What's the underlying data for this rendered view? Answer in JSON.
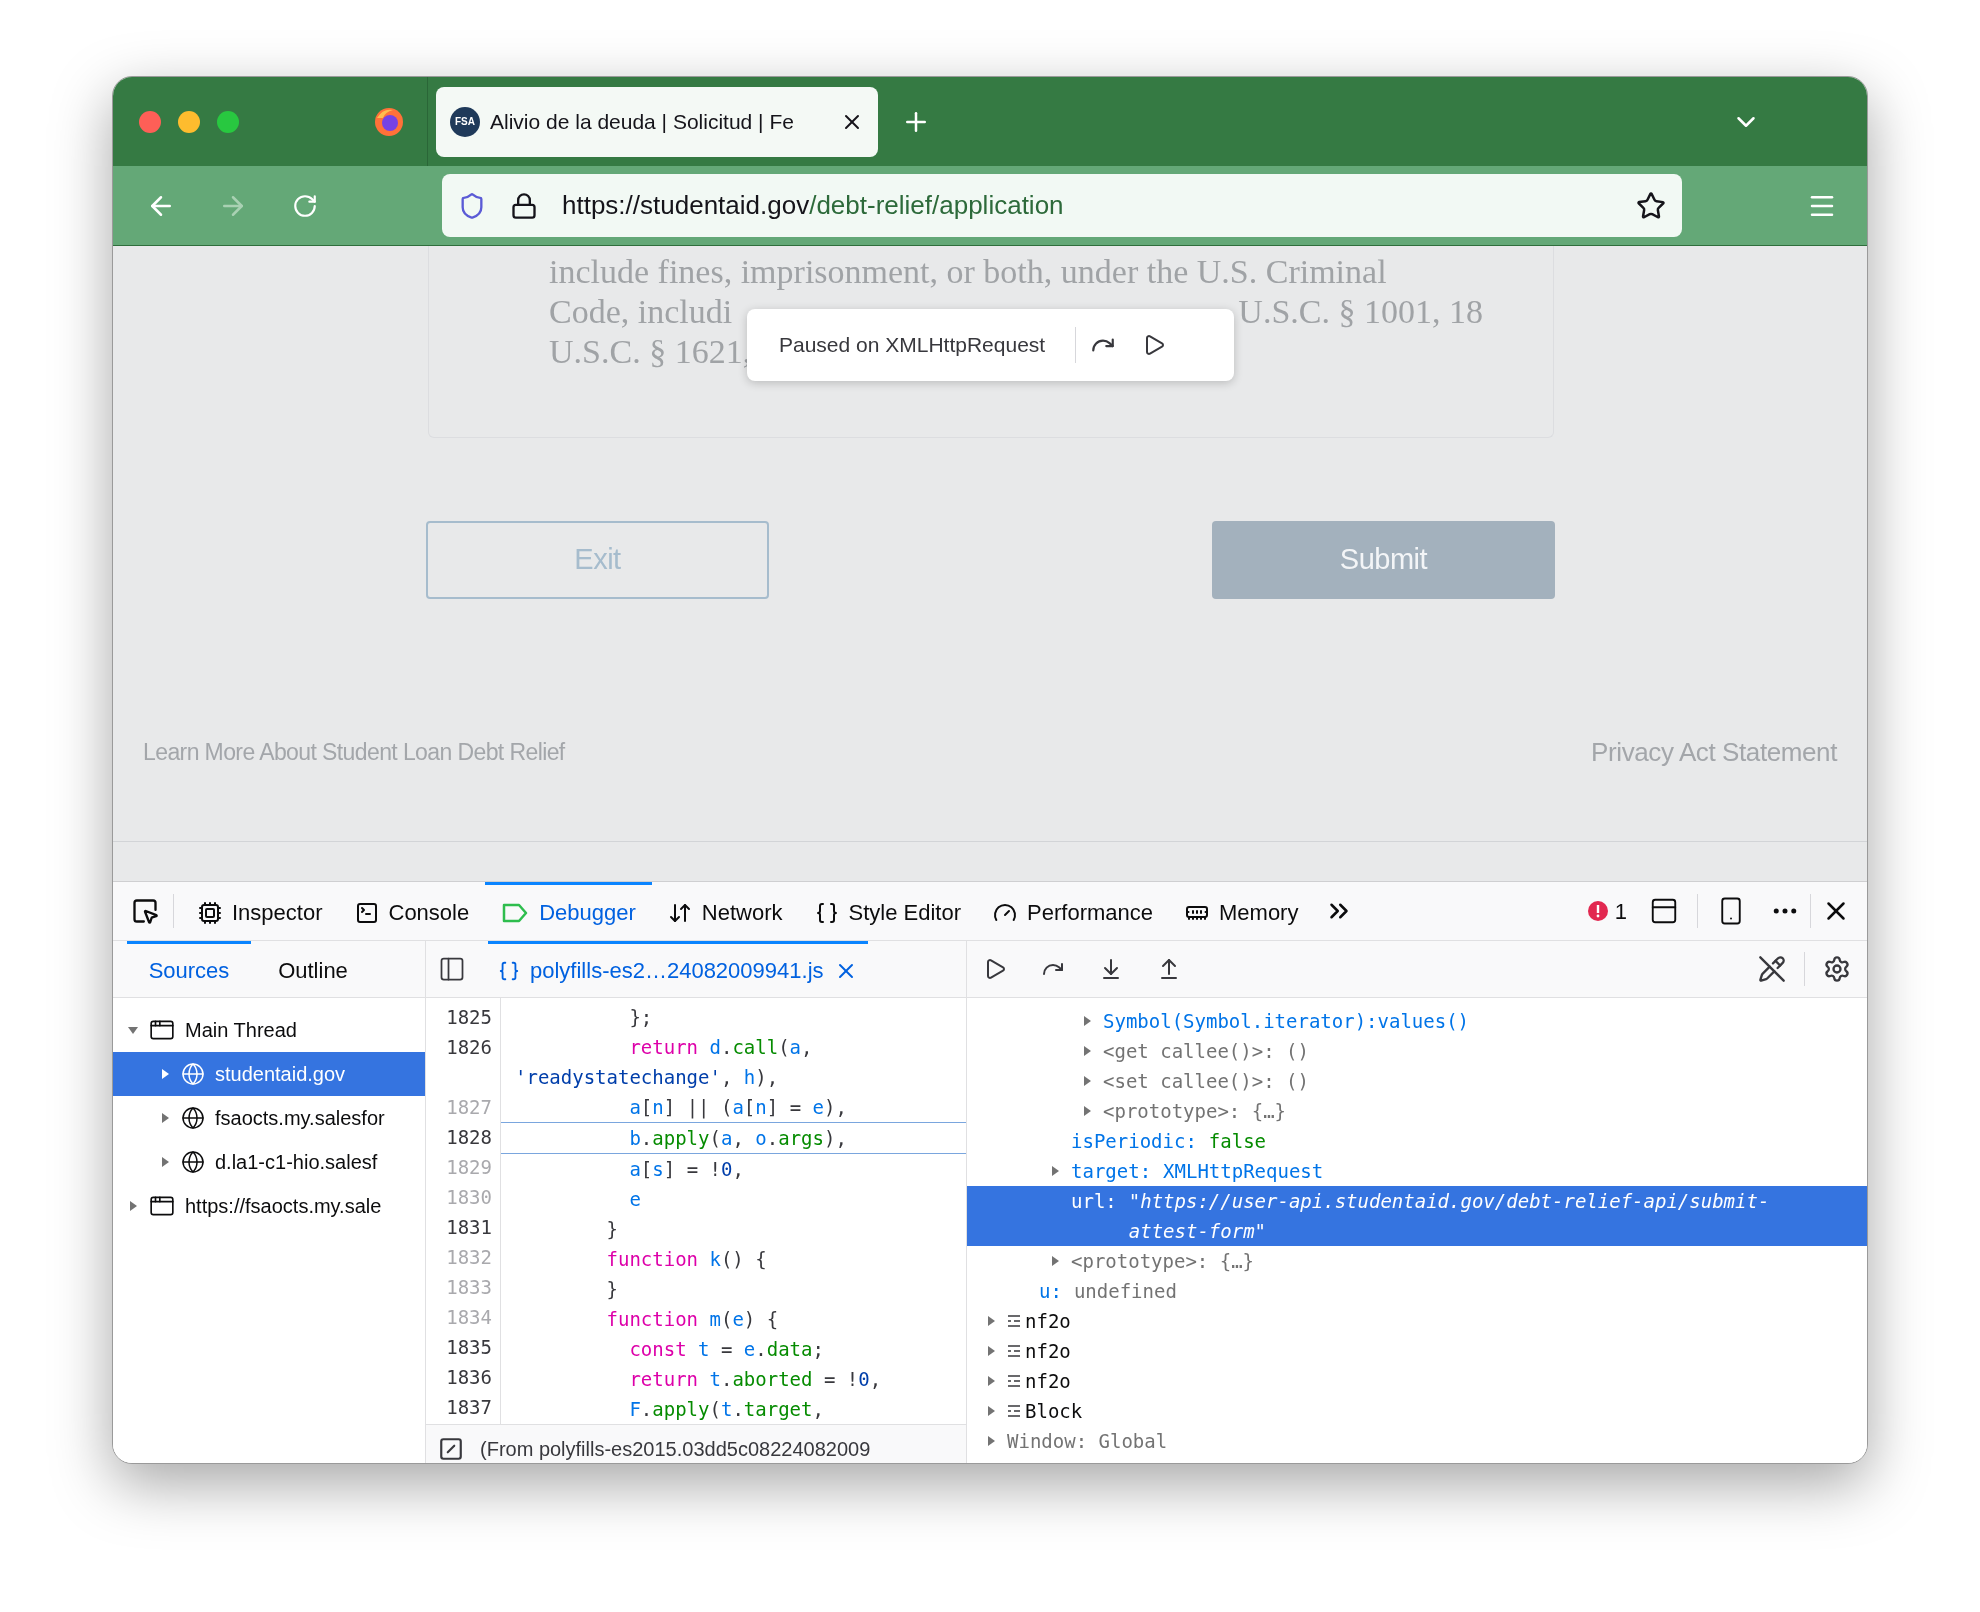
{
  "browser": {
    "tab": {
      "favicon_text": "FSA",
      "title": "Alivio de la deuda | Solicitud | Fe",
      "selected": true
    },
    "nav_buttons": [
      {
        "kind": "back",
        "disabled": false
      },
      {
        "kind": "forward",
        "disabled": true
      },
      {
        "kind": "reload",
        "disabled": false
      }
    ],
    "url": {
      "host": "https://studentaid.gov",
      "path": "/debt-relief/application"
    }
  },
  "page": {
    "legal_text": [
      {
        "parts": [
          "include fines, imprisonment, or both, under the U.S. Criminal"
        ]
      },
      {
        "parts": [
          "Code, includi",
          "U.S.C. § 1001, 18"
        ]
      },
      {
        "parts": [
          "U.S.C. § 1621,"
        ]
      }
    ],
    "paused_popup": {
      "label": "Paused on XMLHttpRequest"
    },
    "buttons": [
      {
        "label": "Exit",
        "kind": "outline"
      },
      {
        "label": "Submit",
        "kind": "filled"
      }
    ],
    "footer_links": [
      "Learn More About Student Loan Debt Relief",
      "Privacy Act Statement"
    ]
  },
  "devtools": {
    "tools": [
      {
        "label": "Inspector",
        "kind": "inspector",
        "selected": false
      },
      {
        "label": "Console",
        "kind": "console",
        "selected": false
      },
      {
        "label": "Debugger",
        "kind": "debugger",
        "selected": true
      },
      {
        "label": "Network",
        "kind": "network",
        "selected": false
      },
      {
        "label": "Style Editor",
        "kind": "style",
        "selected": false
      },
      {
        "label": "Performance",
        "kind": "performance",
        "selected": false
      },
      {
        "label": "Memory",
        "kind": "memory",
        "selected": false
      }
    ],
    "error_count": "1",
    "sidebar_tabs": [
      {
        "label": "Sources",
        "selected": true
      },
      {
        "label": "Outline",
        "selected": false
      }
    ],
    "source_tree": [
      {
        "label": "Main Thread",
        "kind": "thread",
        "expanded": true,
        "selected": false,
        "children": [
          {
            "label": "studentaid.gov",
            "kind": "domain",
            "expanded": false,
            "selected": true
          },
          {
            "label": "fsaocts.my.salesfor",
            "kind": "domain",
            "expanded": false,
            "selected": false
          },
          {
            "label": "d.la1-c1-hio.salesf",
            "kind": "domain",
            "expanded": false,
            "selected": false
          }
        ]
      },
      {
        "label": "https://fsaocts.my.sale",
        "kind": "thread",
        "expanded": false,
        "selected": false
      }
    ],
    "file_tab": {
      "label": "polyfills-es2…24082009941.js",
      "selected": true
    },
    "code_lines": [
      {
        "number": "1825",
        "breakable": true,
        "paused": false,
        "tokens": [
          {
            "kind": "punct",
            "text": "          };"
          }
        ]
      },
      {
        "number": "1826",
        "breakable": true,
        "paused": false,
        "tokens": [
          {
            "kind": "kw",
            "text": "          return"
          },
          {
            "kind": "id",
            "text": " d"
          },
          {
            "kind": "punct",
            "text": "."
          },
          {
            "kind": "prop",
            "text": "call"
          },
          {
            "kind": "punct",
            "text": "("
          },
          {
            "kind": "id",
            "text": "a"
          },
          {
            "kind": "punct",
            "text": ","
          },
          {
            "kind": "nl"
          },
          {
            "kind": "str",
            "text": "'readystatechange'"
          },
          {
            "kind": "punct",
            "text": ", "
          },
          {
            "kind": "id",
            "text": "h"
          },
          {
            "kind": "punct",
            "text": "),"
          }
        ]
      },
      {
        "number": "1827",
        "breakable": false,
        "paused": false,
        "tokens": [
          {
            "kind": "id",
            "text": "          a"
          },
          {
            "kind": "punct",
            "text": "["
          },
          {
            "kind": "id",
            "text": "n"
          },
          {
            "kind": "punct",
            "text": "] || ("
          },
          {
            "kind": "id",
            "text": "a"
          },
          {
            "kind": "punct",
            "text": "["
          },
          {
            "kind": "id",
            "text": "n"
          },
          {
            "kind": "punct",
            "text": "] = "
          },
          {
            "kind": "id",
            "text": "e"
          },
          {
            "kind": "punct",
            "text": "),"
          }
        ]
      },
      {
        "number": "1828",
        "breakable": true,
        "paused": true,
        "tokens": [
          {
            "kind": "id",
            "text": "          b"
          },
          {
            "kind": "punct",
            "text": "."
          },
          {
            "kind": "prop",
            "text": "apply"
          },
          {
            "kind": "punct",
            "text": "("
          },
          {
            "kind": "id",
            "text": "a"
          },
          {
            "kind": "punct",
            "text": ", "
          },
          {
            "kind": "id",
            "text": "o"
          },
          {
            "kind": "punct",
            "text": "."
          },
          {
            "kind": "prop",
            "text": "args"
          },
          {
            "kind": "punct",
            "text": "),"
          }
        ]
      },
      {
        "number": "1829",
        "breakable": false,
        "paused": false,
        "tokens": [
          {
            "kind": "id",
            "text": "          a"
          },
          {
            "kind": "punct",
            "text": "["
          },
          {
            "kind": "id",
            "text": "s"
          },
          {
            "kind": "punct",
            "text": "] = !"
          },
          {
            "kind": "num",
            "text": "0"
          },
          {
            "kind": "punct",
            "text": ","
          }
        ]
      },
      {
        "number": "1830",
        "breakable": false,
        "paused": false,
        "tokens": [
          {
            "kind": "id",
            "text": "          e"
          }
        ]
      },
      {
        "number": "1831",
        "breakable": true,
        "paused": false,
        "tokens": [
          {
            "kind": "punct",
            "text": "        }"
          }
        ]
      },
      {
        "number": "1832",
        "breakable": false,
        "paused": false,
        "tokens": [
          {
            "kind": "kw",
            "text": "        function"
          },
          {
            "kind": "id",
            "text": " k"
          },
          {
            "kind": "punct",
            "text": "() {"
          }
        ]
      },
      {
        "number": "1833",
        "breakable": false,
        "paused": false,
        "tokens": [
          {
            "kind": "punct",
            "text": "        }"
          }
        ]
      },
      {
        "number": "1834",
        "breakable": false,
        "paused": false,
        "tokens": [
          {
            "kind": "kw",
            "text": "        function"
          },
          {
            "kind": "id",
            "text": " m"
          },
          {
            "kind": "punct",
            "text": "("
          },
          {
            "kind": "id",
            "text": "e"
          },
          {
            "kind": "punct",
            "text": ") {"
          }
        ]
      },
      {
        "number": "1835",
        "breakable": true,
        "paused": false,
        "tokens": [
          {
            "kind": "kw",
            "text": "          const"
          },
          {
            "kind": "id",
            "text": " t"
          },
          {
            "kind": "punct",
            "text": " = "
          },
          {
            "kind": "id",
            "text": "e"
          },
          {
            "kind": "punct",
            "text": "."
          },
          {
            "kind": "prop",
            "text": "data"
          },
          {
            "kind": "punct",
            "text": ";"
          }
        ]
      },
      {
        "number": "1836",
        "breakable": true,
        "paused": false,
        "tokens": [
          {
            "kind": "kw",
            "text": "          return"
          },
          {
            "kind": "id",
            "text": " t"
          },
          {
            "kind": "punct",
            "text": "."
          },
          {
            "kind": "prop",
            "text": "aborted"
          },
          {
            "kind": "punct",
            "text": " = !"
          },
          {
            "kind": "num",
            "text": "0"
          },
          {
            "kind": "punct",
            "text": ","
          }
        ]
      },
      {
        "number": "1837",
        "breakable": true,
        "paused": false,
        "tokens": [
          {
            "kind": "id",
            "text": "          F"
          },
          {
            "kind": "punct",
            "text": "."
          },
          {
            "kind": "prop",
            "text": "apply"
          },
          {
            "kind": "punct",
            "text": "("
          },
          {
            "kind": "id",
            "text": "t"
          },
          {
            "kind": "punct",
            "text": "."
          },
          {
            "kind": "prop",
            "text": "target"
          },
          {
            "kind": "punct",
            "text": ","
          }
        ]
      }
    ],
    "source_status": "(From polyfills-es2015.03dd5c08224082009",
    "scope_tree": [
      {
        "children": [
          {
            "children": [
              {
                "children": [
                  {
                    "kind": "symbol",
                    "label": "Symbol(Symbol.iterator):values()",
                    "expandable": true,
                    "selected": false
                  },
                  {
                    "kind": "internal",
                    "label": "<get callee()>: ()",
                    "expandable": true,
                    "selected": false
                  },
                  {
                    "kind": "internal",
                    "label": "<set callee()>: ()",
                    "expandable": true,
                    "selected": false
                  },
                  {
                    "kind": "internal",
                    "label": "<prototype>: {…}",
                    "expandable": true,
                    "selected": false
                  }
                ]
              },
              {
                "kind": "bool_property",
                "label": "isPeriodic:",
                "value": "false",
                "expandable": false,
                "selected": false
              },
              {
                "kind": "object_property",
                "label": "target:",
                "value": "XMLHttpRequest",
                "expandable": true,
                "selected": false
              },
              {
                "kind": "string_property",
                "label": "url:",
                "value": "\"https://user-api.studentaid.gov/debt-relief-api/submit-attest-form\"",
                "expandable": false,
                "selected": true
              },
              {
                "kind": "internal",
                "label": "<prototype>: {…}",
                "expandable": true,
                "selected": false
              }
            ]
          },
          {
            "kind": "undefined_property",
            "label": "u:",
            "value": "undefined",
            "expandable": false,
            "selected": false
          }
        ]
      },
      {
        "kind": "scope",
        "label": "nf2o",
        "expandable": true,
        "selected": false
      },
      {
        "kind": "scope",
        "label": "nf2o",
        "expandable": true,
        "selected": false
      },
      {
        "kind": "scope",
        "label": "nf2o",
        "expandable": true,
        "selected": false
      },
      {
        "kind": "scope",
        "label": "Block",
        "expandable": true,
        "selected": false
      },
      {
        "kind": "global",
        "label": "Window: Global",
        "expandable": true,
        "selected": false
      }
    ]
  }
}
